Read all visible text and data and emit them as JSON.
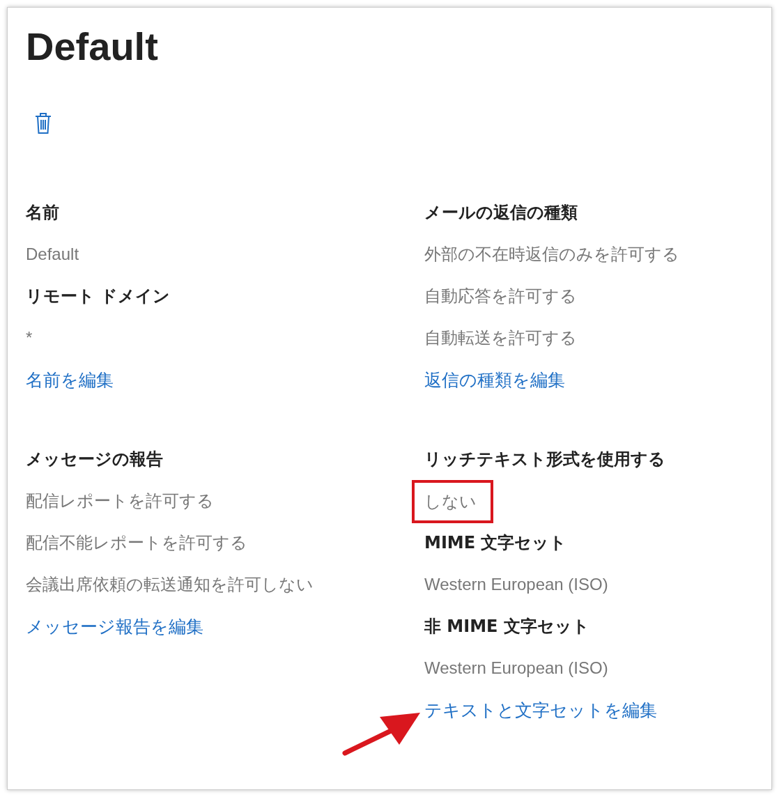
{
  "title": "Default",
  "groups": [
    {
      "items": [
        {
          "kind": "heading",
          "text": "名前"
        },
        {
          "kind": "value",
          "text": "Default",
          "highlighted": false
        },
        {
          "kind": "heading",
          "text": "リモート ドメイン"
        },
        {
          "kind": "value",
          "text": "*",
          "highlighted": false
        },
        {
          "kind": "link",
          "text": "名前を編集"
        }
      ]
    },
    {
      "items": [
        {
          "kind": "heading",
          "text": "メールの返信の種類"
        },
        {
          "kind": "value",
          "text": "外部の不在時返信のみを許可する",
          "highlighted": false
        },
        {
          "kind": "value",
          "text": "自動応答を許可する",
          "highlighted": false
        },
        {
          "kind": "value",
          "text": "自動転送を許可する",
          "highlighted": false
        },
        {
          "kind": "link",
          "text": "返信の種類を編集"
        }
      ]
    },
    {
      "items": [
        {
          "kind": "heading",
          "text": "メッセージの報告"
        },
        {
          "kind": "value",
          "text": "配信レポートを許可する",
          "highlighted": false
        },
        {
          "kind": "value",
          "text": "配信不能レポートを許可する",
          "highlighted": false
        },
        {
          "kind": "value",
          "text": "会議出席依頼の転送通知を許可しない",
          "highlighted": false
        },
        {
          "kind": "link",
          "text": "メッセージ報告を編集"
        }
      ]
    },
    {
      "items": [
        {
          "kind": "heading",
          "text": "リッチテキスト形式を使用する"
        },
        {
          "kind": "value",
          "text": "しない",
          "highlighted": true
        },
        {
          "kind": "heading",
          "text": "MIME 文字セット"
        },
        {
          "kind": "value",
          "text": "Western European (ISO)",
          "highlighted": false
        },
        {
          "kind": "heading",
          "text": "非 MIME 文字セット"
        },
        {
          "kind": "value",
          "text": "Western European (ISO)",
          "highlighted": false
        },
        {
          "kind": "link",
          "text": "テキストと文字セットを編集"
        }
      ]
    }
  ]
}
